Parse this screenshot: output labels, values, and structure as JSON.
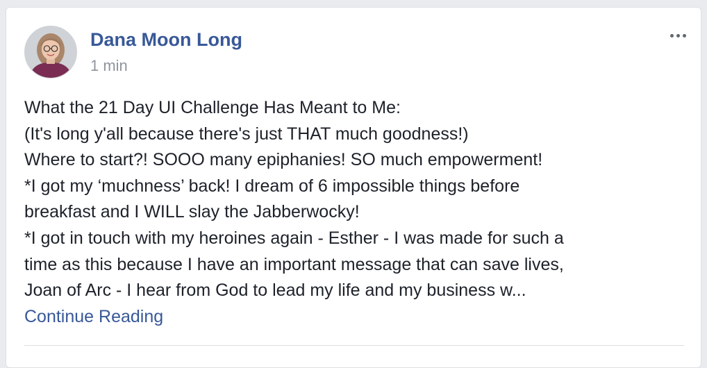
{
  "post": {
    "author": "Dana Moon Long",
    "timestamp": "1 min",
    "more_icon": "more-horizontal-icon",
    "body_lines": [
      "What the 21 Day UI Challenge Has Meant to Me:",
      "(It's long y'all because there's just THAT much goodness!)",
      "Where to start?! SOOO many epiphanies! SO much empowerment!",
      "*I got my ‘muchness’ back! I dream of 6 impossible things before",
      "breakfast and I WILL slay the Jabberwocky!",
      "*I got in touch with my heroines again - Esther - I was made for such a",
      "time as this because I have an important message that can save lives,",
      "Joan of Arc - I hear from God to lead my life and my business w..."
    ],
    "continue_label": "Continue Reading"
  },
  "colors": {
    "link": "#385898",
    "text": "#1d2129",
    "meta": "#90949c",
    "background": "#e9ebee"
  }
}
